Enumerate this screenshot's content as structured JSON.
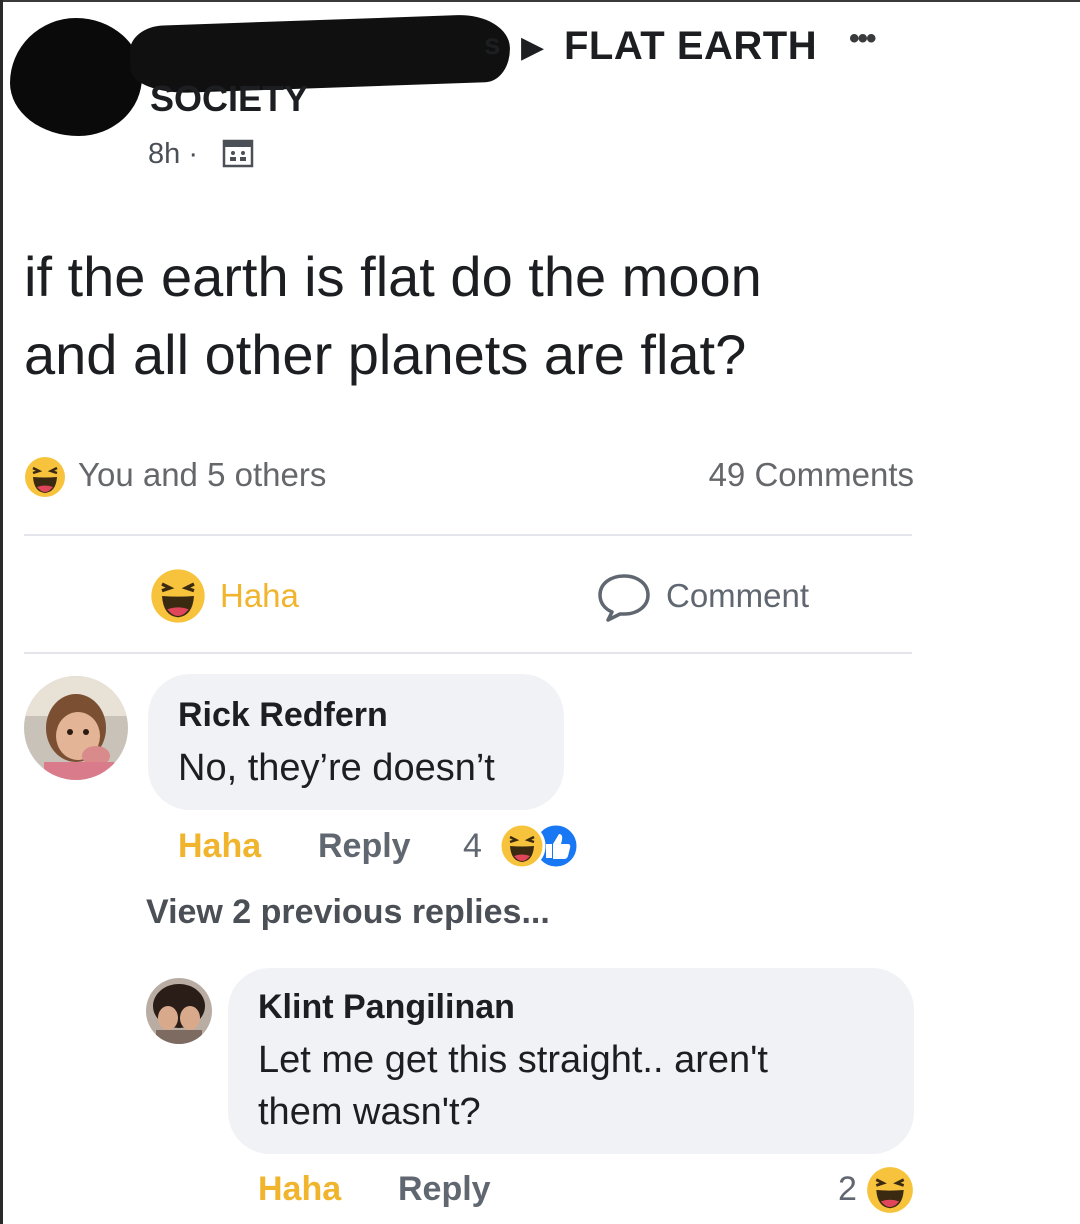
{
  "header": {
    "name_tail": "s",
    "group_name": "FLAT EARTH",
    "group_name_line2": "SOCIETY",
    "timestamp": "8h ·",
    "more_icon": "more-dots-icon",
    "privacy_icon": "group-icon"
  },
  "post": {
    "text_line1": "if the earth is flat do the moon",
    "text_line2": "and all other planets are flat?"
  },
  "reactions": {
    "summary": "You and 5 others",
    "comments_count": "49 Comments",
    "emoji": "haha-emoji-icon"
  },
  "actions": {
    "haha_label": "Haha",
    "comment_label": "Comment"
  },
  "comments": [
    {
      "name": "Rick Redfern",
      "text": "No, they’re doesn’t",
      "haha_label": "Haha",
      "reply_label": "Reply",
      "reaction_count": "4"
    },
    {
      "name": "Klint Pangilinan",
      "text_line1": "Let me get this straight.. aren't",
      "text_line2": "them wasn't?",
      "haha_label": "Haha",
      "reply_label": "Reply",
      "reaction_count": "2"
    }
  ],
  "view_previous": "View 2 previous replies...",
  "colors": {
    "haha_yellow": "#f0b42d",
    "like_blue": "#1877f2",
    "bubble_gray": "#f0f2f5",
    "muted_text": "#65676b"
  }
}
